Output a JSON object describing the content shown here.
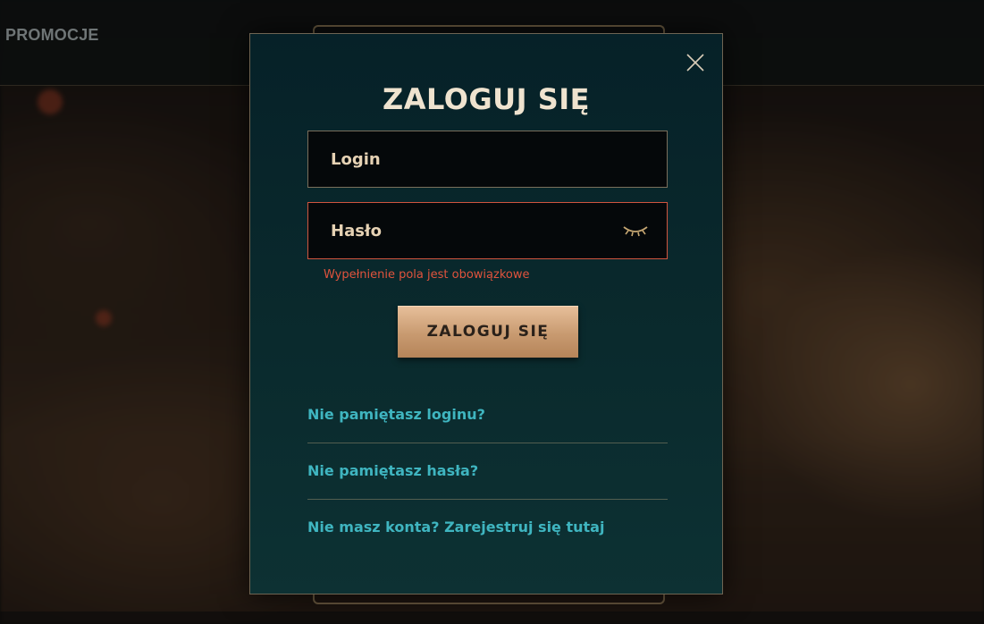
{
  "topbar": {
    "nav_label": "PROMOCJE"
  },
  "modal": {
    "title": "ZALOGUJ SIĘ",
    "close_icon": "close-icon",
    "login_field": {
      "placeholder": "Login",
      "value": ""
    },
    "password_field": {
      "placeholder": "Hasło",
      "value": "",
      "toggle_icon": "eye-closed-icon"
    },
    "password_error": "Wypełnienie pola jest obowiązkowe",
    "submit_label": "ZALOGUJ SIĘ",
    "links": [
      {
        "label": "Nie pamiętasz loginu?"
      },
      {
        "label": "Nie pamiętasz hasła?"
      },
      {
        "label": "Nie masz konta? Zarejestruj się tutaj"
      }
    ]
  },
  "colors": {
    "modal_bg": "#062128",
    "title": "#efe3cf",
    "accent_link": "#3fb5c0",
    "error": "#e0533d",
    "button_gold": "#c89a70"
  }
}
